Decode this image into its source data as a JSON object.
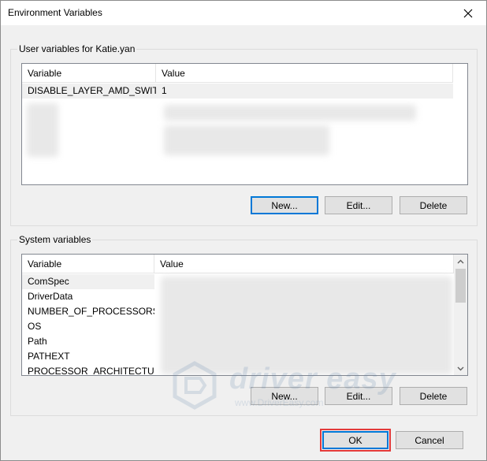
{
  "window": {
    "title": "Environment Variables",
    "close_icon": "close-icon"
  },
  "user_vars": {
    "group_label": "User variables for Katie.yan",
    "columns": [
      "Variable",
      "Value"
    ],
    "rows": [
      {
        "variable": "DISABLE_LAYER_AMD_SWIT...",
        "value": "1"
      }
    ],
    "buttons": {
      "new": "New...",
      "edit": "Edit...",
      "delete": "Delete"
    }
  },
  "system_vars": {
    "group_label": "System variables",
    "columns": [
      "Variable",
      "Value"
    ],
    "rows": [
      {
        "variable": "ComSpec"
      },
      {
        "variable": "DriverData"
      },
      {
        "variable": "NUMBER_OF_PROCESSORS"
      },
      {
        "variable": "OS"
      },
      {
        "variable": "Path"
      },
      {
        "variable": "PATHEXT"
      },
      {
        "variable": "PROCESSOR_ARCHITECTURE"
      }
    ],
    "buttons": {
      "new": "New...",
      "edit": "Edit...",
      "delete": "Delete"
    }
  },
  "footer": {
    "ok": "OK",
    "cancel": "Cancel"
  },
  "watermark": {
    "brand": "driver easy",
    "url": "www.DriverEasy.com"
  },
  "colors": {
    "focus_blue": "#0078d7",
    "highlight_red": "#e33a3a"
  }
}
